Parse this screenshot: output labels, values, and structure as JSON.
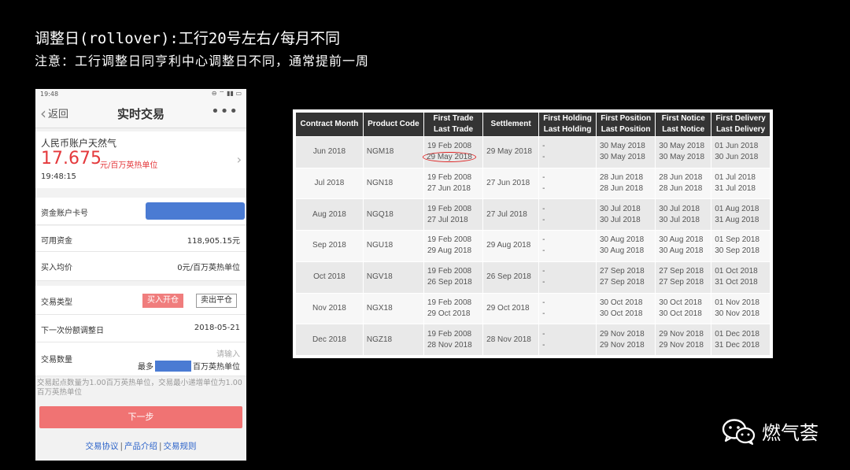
{
  "slide": {
    "title": "调整日(rollover):工行20号左右/每月不同",
    "subtitle": "注意：工行调整日同亨利中心调整日不同，通常提前一周"
  },
  "phone": {
    "status_time": "19:48",
    "back_label": "返回",
    "nav_title": "实时交易",
    "more": "•••",
    "quote": {
      "name": "人民币账户天然气",
      "price": "17.675",
      "unit": "元/百万英热单位",
      "time": "19:48:15"
    },
    "rows": {
      "account_label": "资金账户卡号",
      "available_label": "可用资金",
      "available_value": "118,905.15元",
      "avg_label": "买入均价",
      "avg_value": "0元/百万英热单位",
      "type_label": "交易类型",
      "buy_label": "买入开仓",
      "sell_label": "卖出平仓",
      "rollover_label": "下一次份额调整日",
      "rollover_value": "2018-05-21",
      "qty_label": "交易数量",
      "qty_placeholder": "请输入",
      "qty_max_prefix": "最多",
      "qty_max_suffix": "百万英热单位"
    },
    "note": "交易起点数量为1.00百万英热单位，交易最小递增单位为1.00百万英热单位",
    "next_button": "下一步",
    "links": [
      "交易协议",
      "产品介绍",
      "交易规则"
    ]
  },
  "table": {
    "headers": [
      [
        "Contract Month"
      ],
      [
        "Product Code"
      ],
      [
        "First Trade",
        "Last Trade"
      ],
      [
        "Settlement"
      ],
      [
        "First Holding",
        "Last Holding"
      ],
      [
        "First Position",
        "Last Position"
      ],
      [
        "First Notice",
        "Last Notice"
      ],
      [
        "First Delivery",
        "Last Delivery"
      ]
    ],
    "rows": [
      {
        "month": "Jun 2018",
        "code": "NGM18",
        "trade": [
          "19 Feb 2008",
          "29 May 2018"
        ],
        "settlement": "29 May 2018",
        "holding": [
          "-",
          "-"
        ],
        "position": [
          "30 May 2018",
          "30 May 2018"
        ],
        "notice": [
          "30 May 2018",
          "30 May 2018"
        ],
        "delivery": [
          "01 Jun 2018",
          "30 Jun 2018"
        ]
      },
      {
        "month": "Jul 2018",
        "code": "NGN18",
        "trade": [
          "19 Feb 2008",
          "27 Jun 2018"
        ],
        "settlement": "27 Jun 2018",
        "holding": [
          "-",
          "-"
        ],
        "position": [
          "28 Jun 2018",
          "28 Jun 2018"
        ],
        "notice": [
          "28 Jun 2018",
          "28 Jun 2018"
        ],
        "delivery": [
          "01 Jul 2018",
          "31 Jul 2018"
        ]
      },
      {
        "month": "Aug 2018",
        "code": "NGQ18",
        "trade": [
          "19 Feb 2008",
          "27 Jul 2018"
        ],
        "settlement": "27 Jul 2018",
        "holding": [
          "-",
          "-"
        ],
        "position": [
          "30 Jul 2018",
          "30 Jul 2018"
        ],
        "notice": [
          "30 Jul 2018",
          "30 Jul 2018"
        ],
        "delivery": [
          "01 Aug 2018",
          "31 Aug 2018"
        ]
      },
      {
        "month": "Sep 2018",
        "code": "NGU18",
        "trade": [
          "19 Feb 2008",
          "29 Aug 2018"
        ],
        "settlement": "29 Aug 2018",
        "holding": [
          "-",
          "-"
        ],
        "position": [
          "30 Aug 2018",
          "30 Aug 2018"
        ],
        "notice": [
          "30 Aug 2018",
          "30 Aug 2018"
        ],
        "delivery": [
          "01 Sep 2018",
          "30 Sep 2018"
        ]
      },
      {
        "month": "Oct 2018",
        "code": "NGV18",
        "trade": [
          "19 Feb 2008",
          "26 Sep 2018"
        ],
        "settlement": "26 Sep 2018",
        "holding": [
          "-",
          "-"
        ],
        "position": [
          "27 Sep 2018",
          "27 Sep 2018"
        ],
        "notice": [
          "27 Sep 2018",
          "27 Sep 2018"
        ],
        "delivery": [
          "01 Oct 2018",
          "31 Oct 2018"
        ]
      },
      {
        "month": "Nov 2018",
        "code": "NGX18",
        "trade": [
          "19 Feb 2008",
          "29 Oct 2018"
        ],
        "settlement": "29 Oct 2018",
        "holding": [
          "-",
          "-"
        ],
        "position": [
          "30 Oct 2018",
          "30 Oct 2018"
        ],
        "notice": [
          "30 Oct 2018",
          "30 Oct 2018"
        ],
        "delivery": [
          "01 Nov 2018",
          "30 Nov 2018"
        ]
      },
      {
        "month": "Dec 2018",
        "code": "NGZ18",
        "trade": [
          "19 Feb 2008",
          "28 Nov 2018"
        ],
        "settlement": "28 Nov 2018",
        "holding": [
          "-",
          "-"
        ],
        "position": [
          "29 Nov 2018",
          "29 Nov 2018"
        ],
        "notice": [
          "29 Nov 2018",
          "29 Nov 2018"
        ],
        "delivery": [
          "01 Dec 2018",
          "31 Dec 2018"
        ]
      }
    ],
    "highlight_color": "#dd2222"
  },
  "brand": {
    "name": "燃气荟",
    "icon": "wechat-icon"
  }
}
